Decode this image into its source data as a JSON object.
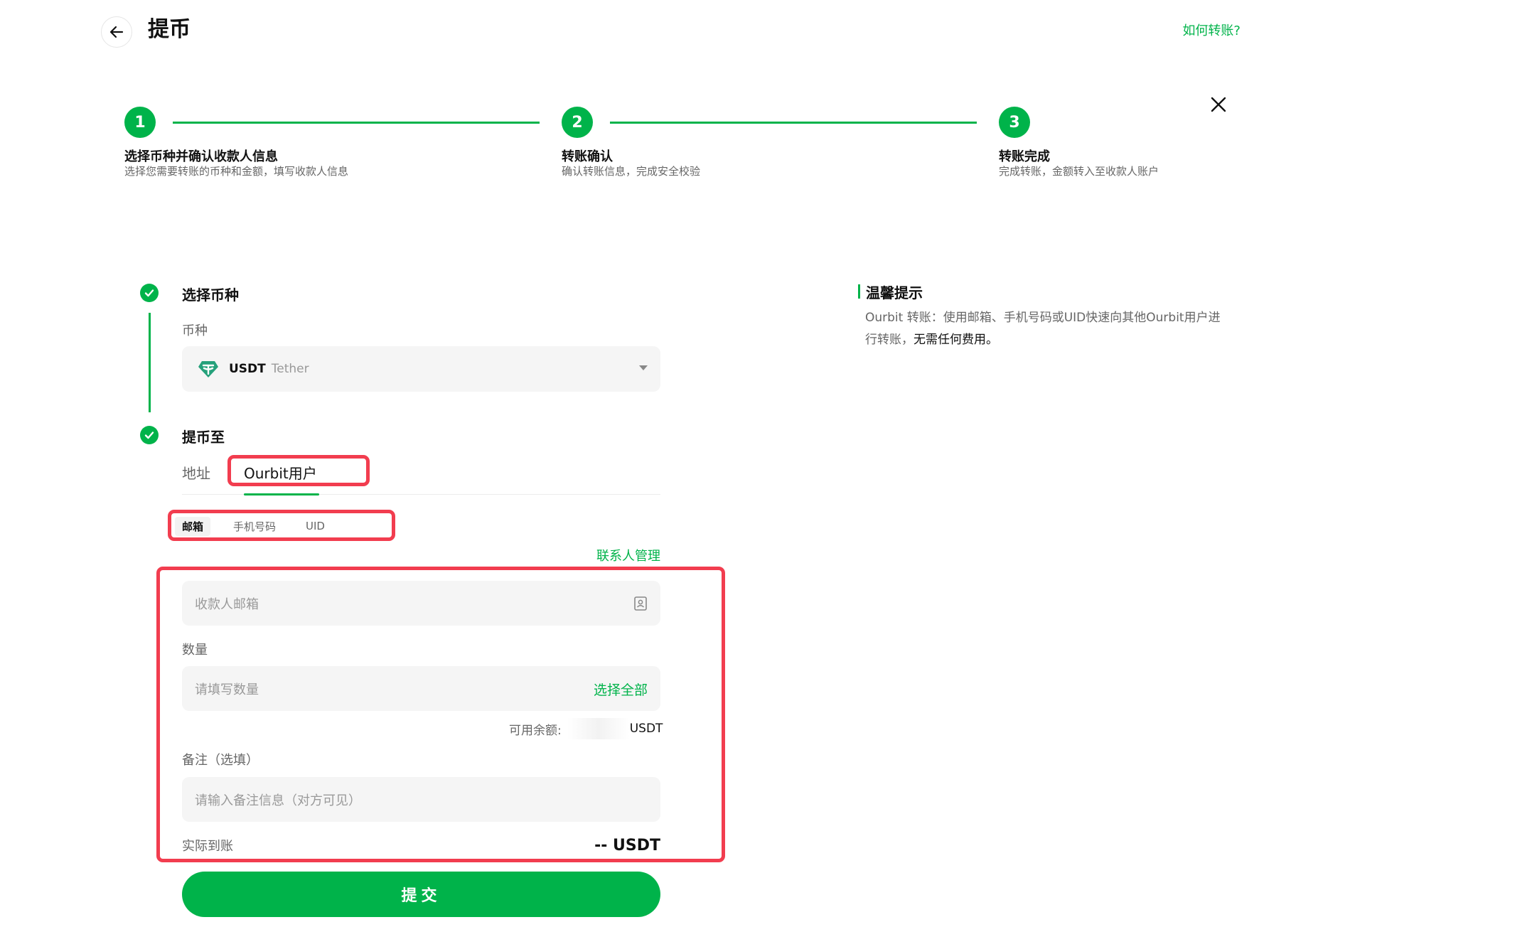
{
  "header": {
    "title": "提币",
    "help_link": "如何转账?"
  },
  "steps": [
    {
      "number": "1",
      "title": "选择币种并确认收款人信息",
      "desc": "选择您需要转账的币种和金额，填写收款人信息"
    },
    {
      "number": "2",
      "title": "转账确认",
      "desc": "确认转账信息，完成安全校验"
    },
    {
      "number": "3",
      "title": "转账完成",
      "desc": "完成转账，金额转入至收款人账户"
    }
  ],
  "coin_section": {
    "title": "选择币种",
    "label": "币种",
    "selected_symbol": "USDT",
    "selected_name": "Tether"
  },
  "withdraw_section": {
    "title": "提币至",
    "tabs": [
      "地址",
      "Ourbit用户"
    ],
    "active_tab": "Ourbit用户",
    "segments": [
      "邮箱",
      "手机号码",
      "UID"
    ],
    "active_segment": "邮箱",
    "contacts_link": "联系人管理",
    "email_placeholder": "收款人邮箱",
    "qty_label": "数量",
    "qty_placeholder": "请填写数量",
    "select_all": "选择全部",
    "balance_label": "可用余额:",
    "balance_unit": "USDT",
    "memo_label": "备注（选填）",
    "memo_placeholder": "请输入备注信息（对方可见）",
    "arrive_label": "实际到账",
    "arrive_value": "-- USDT",
    "submit": "提交"
  },
  "tips": {
    "title": "温馨提示",
    "body_prefix": "Ourbit 转账：使用邮箱、手机号码或UID快速向其他Ourbit用户进行转账，",
    "body_strong": "无需任何费用。"
  },
  "colors": {
    "accent": "#00b34a",
    "highlight": "#f23d4f",
    "tether": "#26a17b"
  }
}
